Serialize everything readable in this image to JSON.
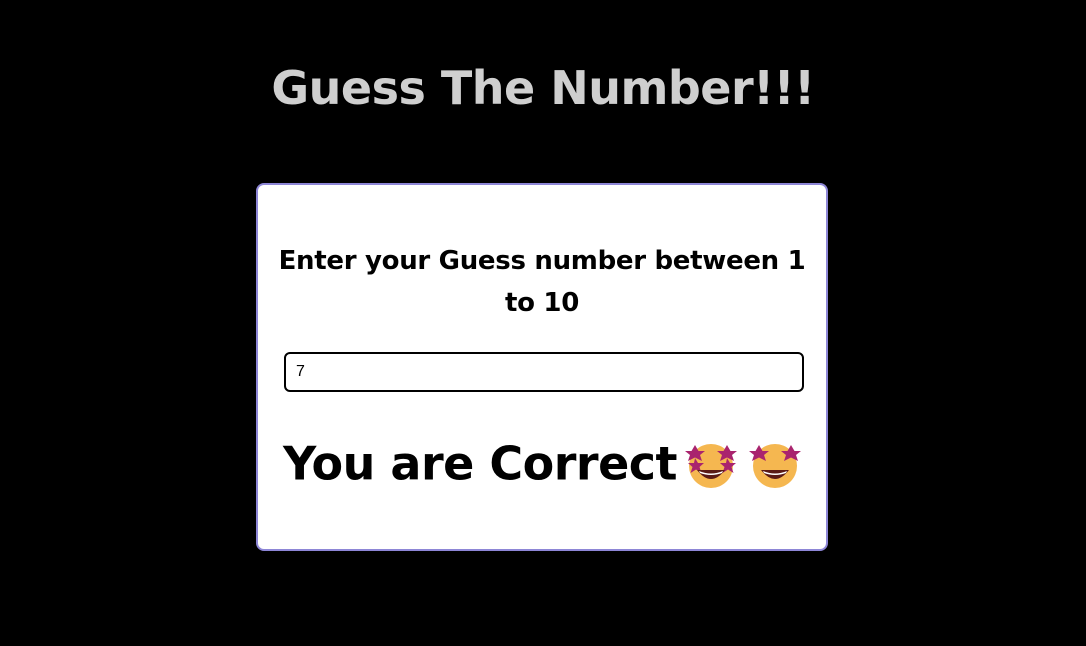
{
  "page": {
    "title": "Guess The Number!!!"
  },
  "card": {
    "prompt": "Enter your Guess number between 1 to 10",
    "input": {
      "value": "7",
      "placeholder": ""
    },
    "result": {
      "text": "You are Correct",
      "icons": [
        "star-struck-emoji-icon",
        "star-struck-emoji-icon"
      ]
    }
  },
  "colors": {
    "background": "#000000",
    "title": "#cfcfcf",
    "card_border": "#8d86d6",
    "emoji_face": "#f5b750",
    "emoji_stars": "#a9246e"
  }
}
